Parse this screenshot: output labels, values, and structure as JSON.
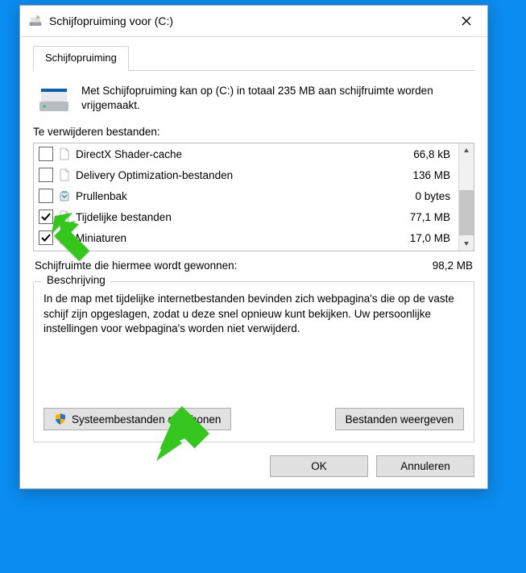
{
  "titlebar": {
    "title": "Schijfopruiming voor  (C:)"
  },
  "tabs": {
    "main": "Schijfopruiming"
  },
  "intro": "Met Schijfopruiming kan op  (C:) in totaal 235 MB aan schijfruimte worden vrijgemaakt.",
  "files_label": "Te verwijderen bestanden:",
  "files": [
    {
      "name": "DirectX Shader-cache",
      "size": "66,8 kB",
      "checked": false,
      "icon": "file"
    },
    {
      "name": "Delivery Optimization-bestanden",
      "size": "136 MB",
      "checked": false,
      "icon": "file"
    },
    {
      "name": "Prullenbak",
      "size": "0 bytes",
      "checked": false,
      "icon": "recycle"
    },
    {
      "name": "Tijdelijke bestanden",
      "size": "77,1 MB",
      "checked": true,
      "icon": "file"
    },
    {
      "name": "Miniaturen",
      "size": "17,0 MB",
      "checked": true,
      "icon": "file"
    }
  ],
  "gain": {
    "label": "Schijfruimte die hiermee wordt gewonnen:",
    "value": "98,2 MB"
  },
  "group": {
    "legend": "Beschrijving",
    "description": "In de map met tijdelijke internetbestanden bevinden zich webpagina's die op de vaste schijf zijn opgeslagen, zodat u deze snel opnieuw kunt bekijken. Uw persoonlijke instellingen voor webpagina's worden niet verwijderd."
  },
  "buttons": {
    "clean_system": "Systeembestanden opschonen",
    "view_files": "Bestanden weergeven",
    "ok": "OK",
    "cancel": "Annuleren"
  }
}
